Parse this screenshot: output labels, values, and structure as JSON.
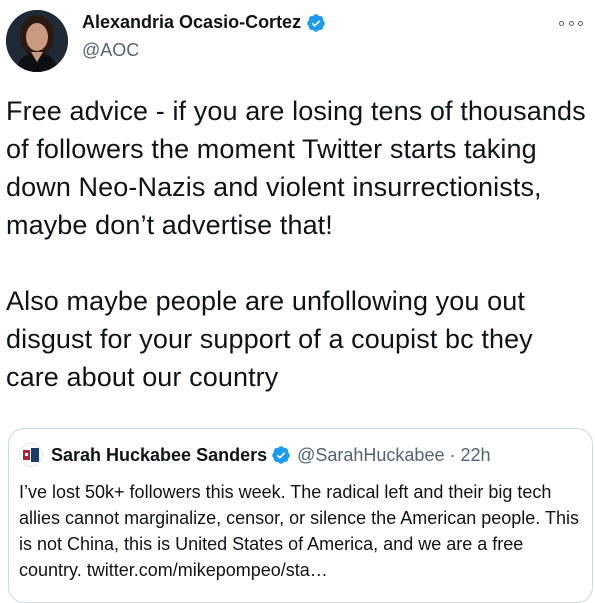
{
  "tweet": {
    "author": {
      "name": "Alexandria Ocasio-Cortez",
      "handle": "@AOC"
    },
    "paragraphs": [
      "Free advice - if you are losing tens of thousands of followers the moment Twitter starts taking down Neo-Nazis and violent insurrectionists, maybe don’t advertise that!",
      "Also maybe people are unfollowing you out disgust for your support of a coupist bc they care about our country"
    ]
  },
  "quoted_tweet": {
    "author": {
      "name": "Sarah Huckabee Sanders",
      "handle": "@SarahHuckabee"
    },
    "separator": "·",
    "time": "22h",
    "text": "I’ve lost 50k+ followers this week. The radical left and their big tech allies cannot marginalize, censor, or silence the American people. This is not China, this is United States of America, and we are a free country. twitter.com/mikepompeo/sta…"
  },
  "colors": {
    "verified": "#1d9bf0",
    "secondary_text": "#536471",
    "border": "#cfd9de"
  }
}
